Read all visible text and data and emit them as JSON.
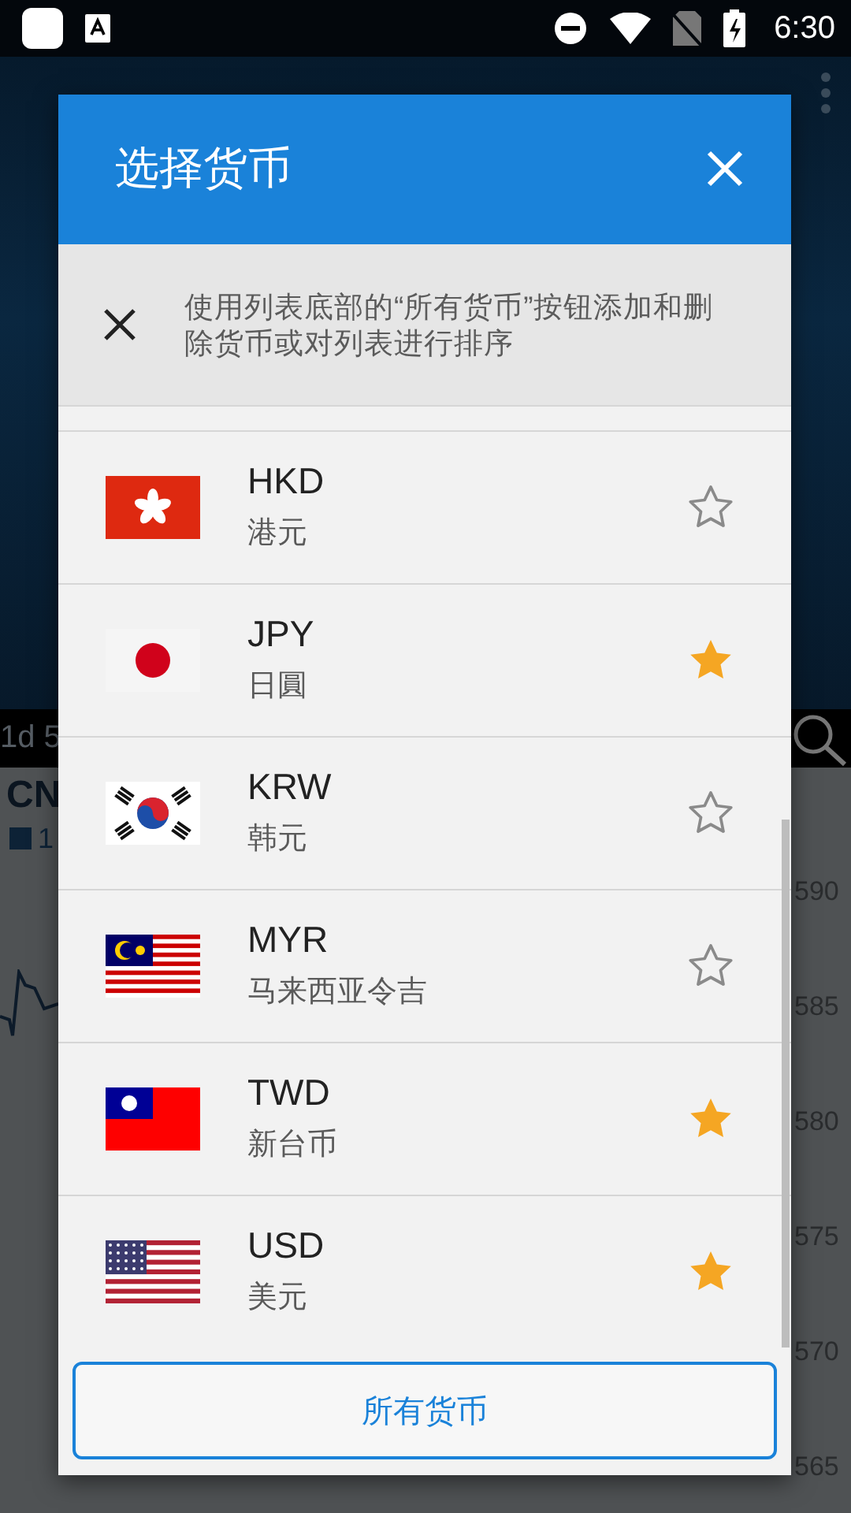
{
  "status_bar": {
    "time": "6:30"
  },
  "background": {
    "range_label": "1d 5",
    "pair_label": "CN",
    "legend_label": "1",
    "axis_labels": [
      "590",
      "585",
      "580",
      "575",
      "570",
      "565"
    ]
  },
  "dialog": {
    "title": "选择货币",
    "hint": "使用列表底部的“所有货币”按钮添加和删除货币或对列表进行排序",
    "currencies": [
      {
        "code": "HKD",
        "name": "港元",
        "kind": "hk",
        "starred": false
      },
      {
        "code": "JPY",
        "name": "日圓",
        "kind": "jp",
        "starred": true
      },
      {
        "code": "KRW",
        "name": "韩元",
        "kind": "kr",
        "starred": false
      },
      {
        "code": "MYR",
        "name": "马来西亚令吉",
        "kind": "my",
        "starred": false
      },
      {
        "code": "TWD",
        "name": "新台币",
        "kind": "tw",
        "starred": true
      },
      {
        "code": "USD",
        "name": "美元",
        "kind": "us",
        "starred": true
      }
    ],
    "all_button": "所有货币"
  }
}
